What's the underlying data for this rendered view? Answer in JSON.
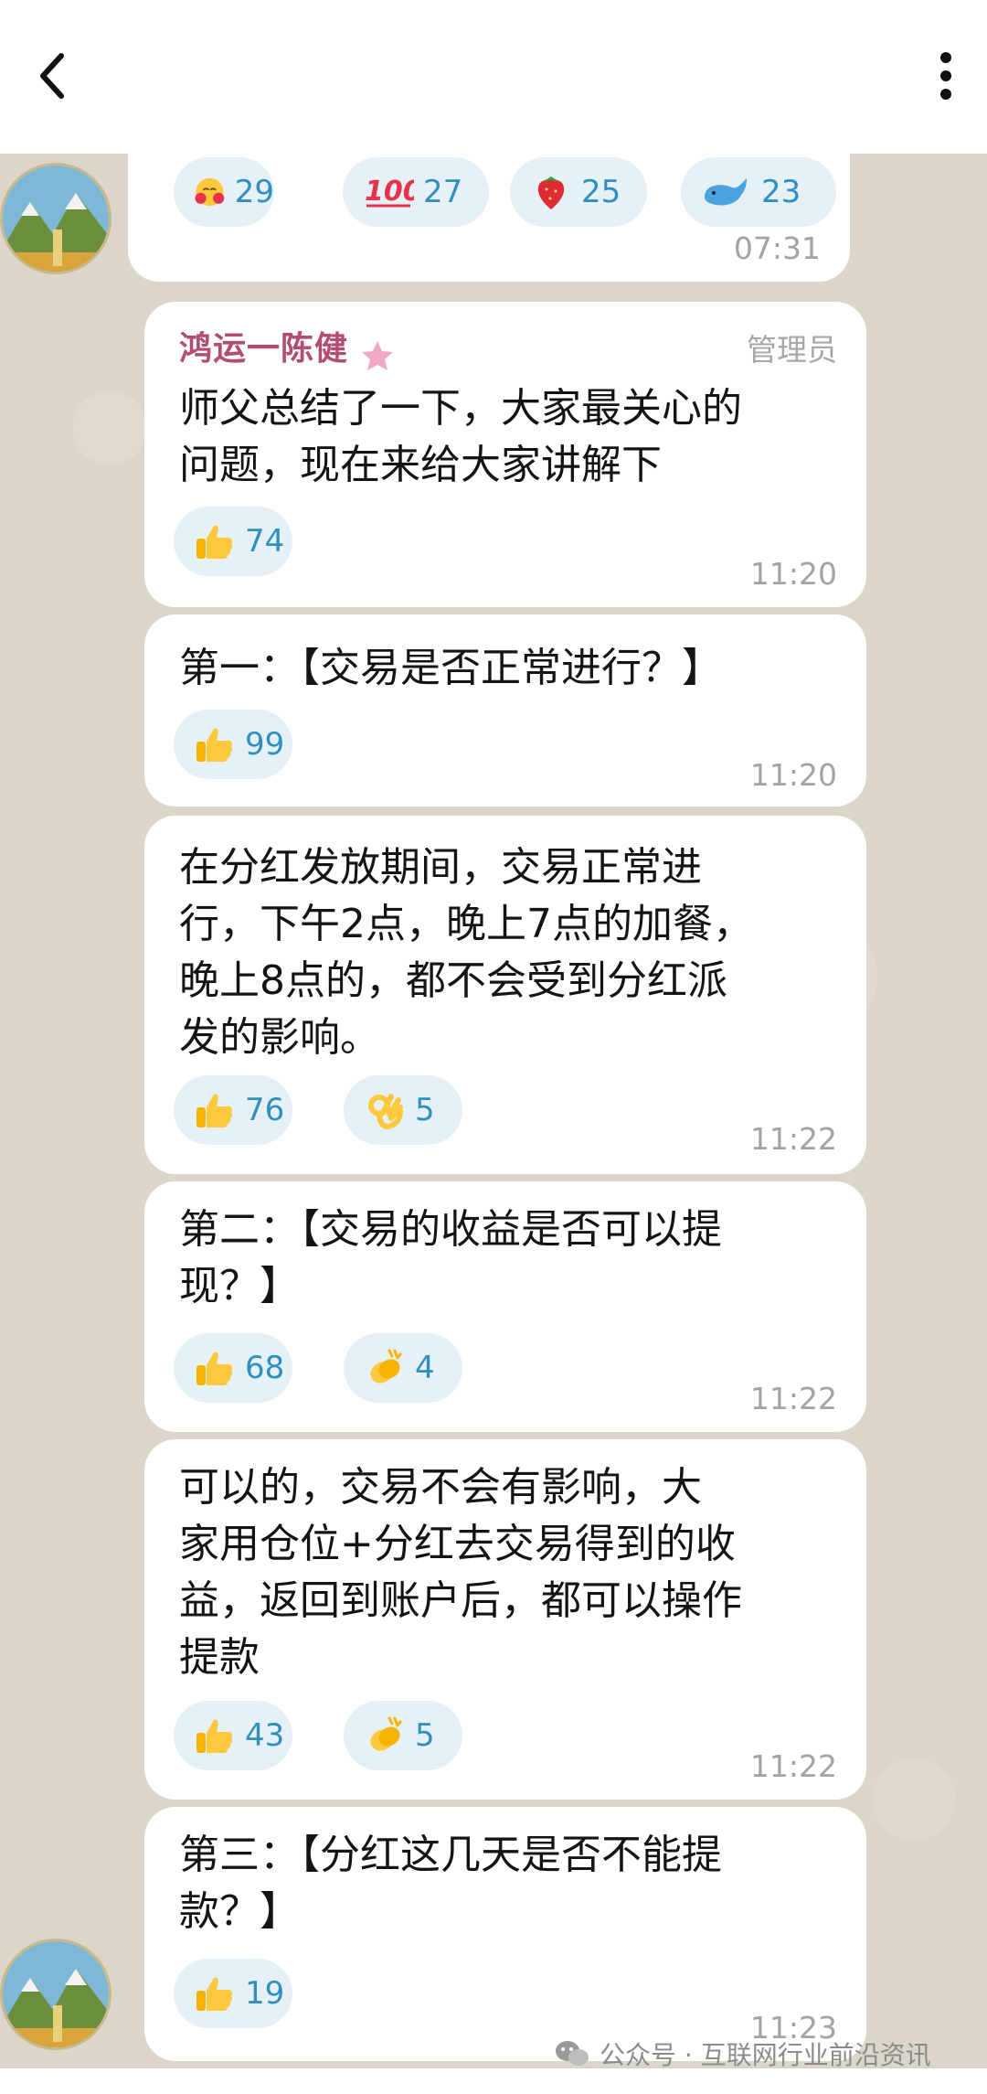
{
  "header": {
    "back_icon": "chevron-left-icon",
    "menu_icon": "more-vertical-icon"
  },
  "messages": [
    {
      "reactions": [
        {
          "icon": "smiling-hearts-emoji-icon",
          "count": "29"
        },
        {
          "icon": "hundred-points-emoji-icon",
          "count": "27"
        },
        {
          "icon": "strawberry-emoji-icon",
          "count": "25"
        },
        {
          "icon": "whale-emoji-icon",
          "count": "23"
        }
      ],
      "time": "07:31"
    },
    {
      "sender": "鸿运一陈健",
      "role": "管理员",
      "lines": [
        "师父总结了一下，大家最关心的",
        "问题，现在来给大家讲解下"
      ],
      "reactions": [
        {
          "icon": "thumbs-up-emoji-icon",
          "count": "74"
        }
      ],
      "time": "11:20"
    },
    {
      "lines": [
        "第一：【交易是否正常进行？】"
      ],
      "reactions": [
        {
          "icon": "thumbs-up-emoji-icon",
          "count": "99"
        }
      ],
      "time": "11:20"
    },
    {
      "lines": [
        "在分红发放期间，交易正常进",
        "行，下午2点，晚上7点的加餐，",
        "晚上8点的，都不会受到分红派",
        "发的影响。"
      ],
      "reactions": [
        {
          "icon": "thumbs-up-emoji-icon",
          "count": "76"
        },
        {
          "icon": "ok-hand-emoji-icon",
          "count": "5"
        }
      ],
      "time": "11:22"
    },
    {
      "lines": [
        "第二：【交易的收益是否可以提",
        "现？】"
      ],
      "reactions": [
        {
          "icon": "thumbs-up-emoji-icon",
          "count": "68"
        },
        {
          "icon": "clapping-hands-emoji-icon",
          "count": "4"
        }
      ],
      "time": "11:22"
    },
    {
      "lines": [
        "可以的，交易不会有影响，大",
        "家用仓位+分红去交易得到的收",
        "益，返回到账户后，都可以操作",
        "提款"
      ],
      "reactions": [
        {
          "icon": "thumbs-up-emoji-icon",
          "count": "43"
        },
        {
          "icon": "clapping-hands-emoji-icon",
          "count": "5"
        }
      ],
      "time": "11:22"
    },
    {
      "lines": [
        "第三：【分红这几天是否不能提",
        "款？】"
      ],
      "reactions": [
        {
          "icon": "thumbs-up-emoji-icon",
          "count": "19"
        }
      ],
      "time": "11:23"
    }
  ],
  "watermark": {
    "text": "公众号 · 互联网行业前沿资讯",
    "icon": "wechat-icon"
  },
  "colors": {
    "sender": "#b24c72",
    "reaction_bg": "#e6f1f7",
    "reaction_count": "#2f8fbf",
    "chat_bg": "#dcd5c9"
  }
}
